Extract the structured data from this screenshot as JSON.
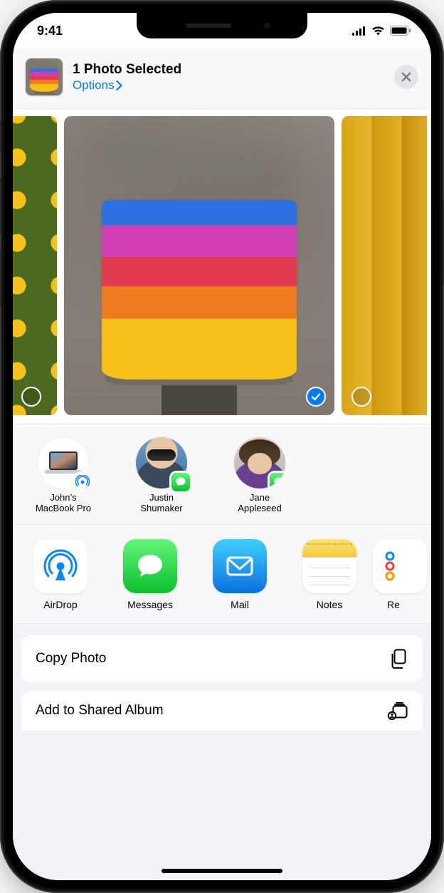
{
  "status": {
    "time": "9:41"
  },
  "header": {
    "title": "1 Photo Selected",
    "options_label": "Options",
    "close_name": "close"
  },
  "photos": [
    {
      "name": "flowers-photo",
      "selected": false
    },
    {
      "name": "rainbow-painting-photo",
      "selected": true
    },
    {
      "name": "hair-photo",
      "selected": false
    }
  ],
  "contacts": [
    {
      "line1": "John’s",
      "line2": "MacBook Pro",
      "badge": "airdrop",
      "avatar": "macbook"
    },
    {
      "line1": "Justin",
      "line2": "Shumaker",
      "badge": "messages",
      "avatar": "person1"
    },
    {
      "line1": "Jane",
      "line2": "Appleseed",
      "badge": "messages",
      "avatar": "person2"
    }
  ],
  "apps": [
    {
      "label": "AirDrop",
      "icon": "airdrop"
    },
    {
      "label": "Messages",
      "icon": "messages"
    },
    {
      "label": "Mail",
      "icon": "mail"
    },
    {
      "label": "Notes",
      "icon": "notes"
    },
    {
      "label": "Re",
      "icon": "reminders"
    }
  ],
  "actions": [
    {
      "label": "Copy Photo",
      "icon": "copy"
    },
    {
      "label": "Add to Shared Album",
      "icon": "shared-album"
    }
  ],
  "colors": {
    "link": "#007aff"
  }
}
